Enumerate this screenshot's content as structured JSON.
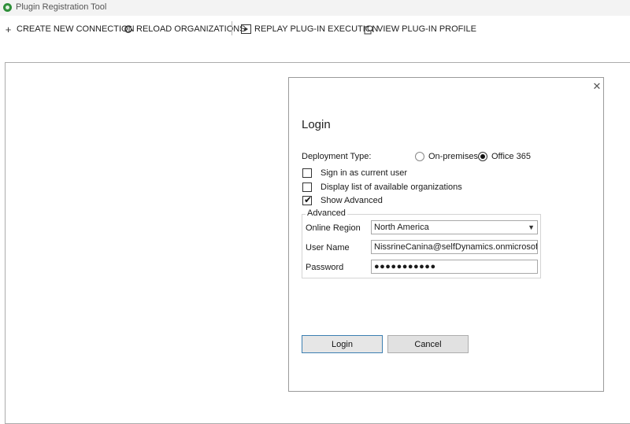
{
  "window": {
    "title": "Plugin Registration Tool"
  },
  "toolbar": {
    "create_connection": {
      "label": "CREATE NEW CONNECTION",
      "icon": "plus-icon"
    },
    "reload_organizations": {
      "label": "RELOAD ORGANIZATIONS",
      "icon": "refresh-icon"
    },
    "replay_execution": {
      "label": "REPLAY PLUG-IN EXECUTION",
      "icon": "replay-icon"
    },
    "view_profile": {
      "label": "VIEW PLUG-IN PROFILE",
      "icon": "profile-icon"
    }
  },
  "login": {
    "title": "Login",
    "close_icon": "close-icon",
    "deployment_type": {
      "label": "Deployment Type:",
      "options": [
        "On-premises",
        "Office 365"
      ],
      "selected": "Office 365"
    },
    "checkboxes": {
      "sign_in_current": {
        "label": "Sign in as current user",
        "checked": false
      },
      "display_orgs": {
        "label": "Display list of available organizations",
        "checked": false
      },
      "show_advanced": {
        "label": "Show Advanced",
        "checked": true
      }
    },
    "advanced": {
      "legend": "Advanced",
      "online_region": {
        "label": "Online Region",
        "value": "North America"
      },
      "user_name": {
        "label": "User Name",
        "value": "NissrineCanina@selfDynamics.onmicrosoft.com"
      },
      "password": {
        "label": "Password",
        "masked": "●●●●●●●●●●●"
      }
    },
    "login_button": "Login",
    "cancel_button": "Cancel"
  },
  "colors": {
    "accent_border": "#3c7fb1",
    "title_bar": "#f3f3f3",
    "app_icon": "#2f8f3a"
  }
}
